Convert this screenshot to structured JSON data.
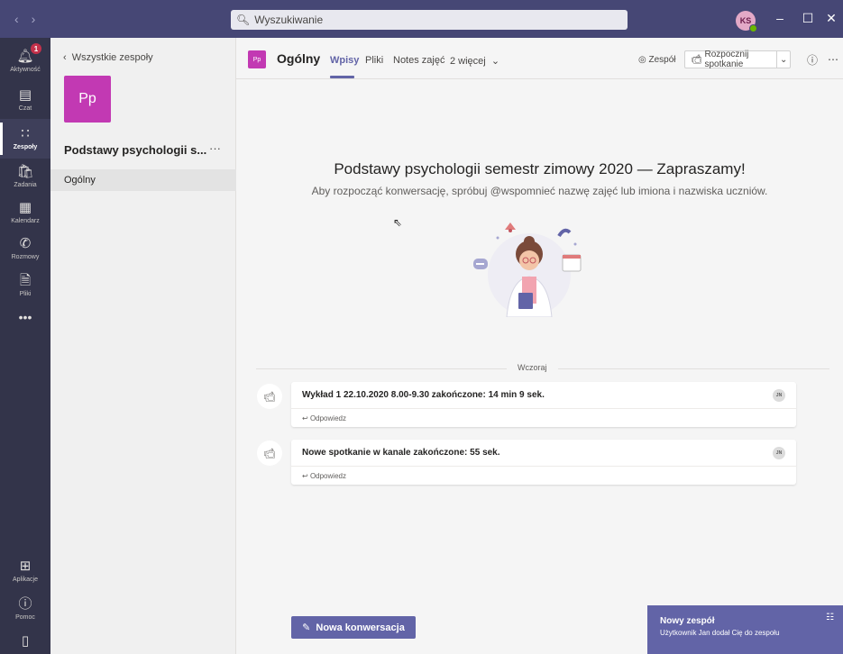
{
  "titlebar": {
    "search_placeholder": "Wyszukiwanie",
    "avatar_initials": "KS"
  },
  "rail": {
    "activity_label": "Aktywność",
    "activity_badge": "1",
    "chat_label": "Czat",
    "teams_label": "Zespoły",
    "assignments_label": "Zadania",
    "calendar_label": "Kalendarz",
    "calls_label": "Rozmowy",
    "files_label": "Pliki",
    "more_label": "...",
    "apps_label": "Aplikacje",
    "help_label": "Pomoc"
  },
  "teampanel": {
    "back_label": "Wszystkie zespoły",
    "team_tile": "Pp",
    "team_name": "Podstawy psychologii s...",
    "team_more": "···",
    "channel": "Ogólny"
  },
  "header": {
    "tile": "Pp",
    "title": "Ogólny",
    "tabs": [
      "Wpisy",
      "Pliki",
      "Notes zajęć",
      "2 więcej"
    ],
    "team_button": "Zespół",
    "meet_button": "Rozpocznij spotkanie"
  },
  "welcome": {
    "title": "Podstawy psychologii semestr zimowy 2020 — Zapraszamy!",
    "subtitle": "Aby rozpocząć konwersację, spróbuj @wspomnieć nazwę zajęć lub imiona i nazwiska uczniów."
  },
  "feed": {
    "date_label": "Wczoraj",
    "messages": [
      {
        "text": "Wykład 1 22.10.2020 8.00-9.30 zakończone: 14 min 9 sek.",
        "reply": "Odpowiedz",
        "initials": "JN"
      },
      {
        "text": "Nowe spotkanie w kanale zakończone: 55 sek.",
        "reply": "Odpowiedz",
        "initials": "JN"
      }
    ]
  },
  "compose": {
    "new_conversation": "Nowa konwersacja"
  },
  "toast": {
    "title": "Nowy zespół",
    "body": "Użytkownik Jan dodał Cię do zespołu"
  },
  "colors": {
    "brand": "#6264a7",
    "titlebar": "#464775",
    "rail": "#33344a",
    "team_tile": "#c239b3"
  }
}
